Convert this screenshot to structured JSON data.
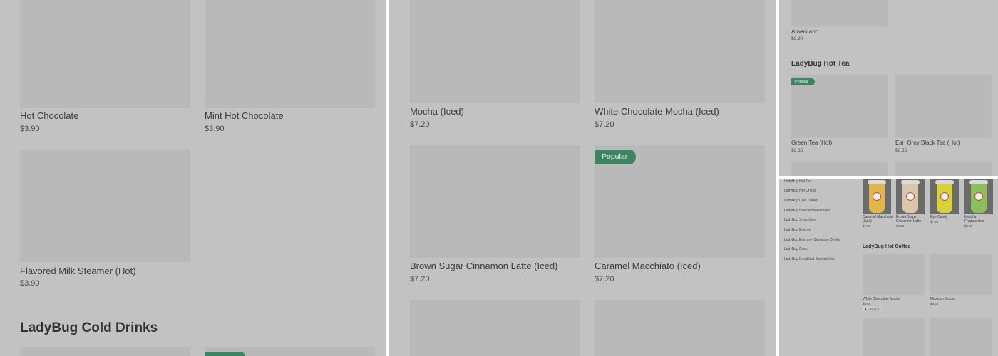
{
  "panel1": {
    "items": [
      {
        "name": "Hot Chocolate",
        "price": "$3.90"
      },
      {
        "name": "Mint Hot Chocolate",
        "price": "$3.90"
      },
      {
        "name": "Flavored Milk Steamer (Hot)",
        "price": "$3.90"
      }
    ],
    "section_heading": "LadyBug Cold Drinks"
  },
  "panel2": {
    "items": [
      {
        "name": "Mocha (Iced)",
        "price": "$7.20"
      },
      {
        "name": "White Chocolate Mocha (Iced)",
        "price": "$7.20"
      },
      {
        "name": "Brown Sugar Cinnamon Latte (Iced)",
        "price": "$7.20"
      },
      {
        "name": "Caramel Macchiato (Iced)",
        "price": "$7.20"
      }
    ],
    "badge": "Popular"
  },
  "panel3": {
    "top_item": {
      "name": "Americano",
      "price": "$3.90"
    },
    "section_heading": "LadyBug Hot Tea",
    "badge": "Popular",
    "items": [
      {
        "name": "Green Tea (Hot)",
        "price": "$3.35"
      },
      {
        "name": "Earl Grey Black Tea (Hot)",
        "price": "$3.35"
      }
    ]
  },
  "panel4": {
    "nav": [
      "LadyBug Hot Tea",
      "LadyBug Hot Drinks",
      "LadyBug Cold Drinks",
      "LadyBug Blended Beverages",
      "LadyBug Smoothies",
      "LadyBug Energy",
      "LadyBug Energy - Signature Drinks",
      "LadyBug Bites",
      "LadyBug Breakfast Sandwiches"
    ],
    "featured": [
      {
        "name": "Caramel Macchiato (Iced)",
        "price": "$7.20",
        "cup_color": "#e3b64a"
      },
      {
        "name": "Brown Sugar Cinnamon Latte",
        "price": "$6.60",
        "cup_color": "#d8c8a8"
      },
      {
        "name": "Eye Candy",
        "price": "$7.45",
        "cup_color": "#d8d23a"
      },
      {
        "name": "Matcha Frappuccino",
        "price": "$6.45",
        "cup_color": "#8bbf5a"
      }
    ],
    "section_heading": "LadyBug Hot Coffee",
    "items": [
      {
        "name": "White Chocolate Mocha",
        "price": "$6.60",
        "rating": "75% (4)"
      },
      {
        "name": "Mexican Mocha",
        "price": "$6.60"
      }
    ]
  },
  "colors": {
    "overlay": "#c2c2c2",
    "placeholder": "#b9b9b9",
    "badge": "#3e8462"
  }
}
